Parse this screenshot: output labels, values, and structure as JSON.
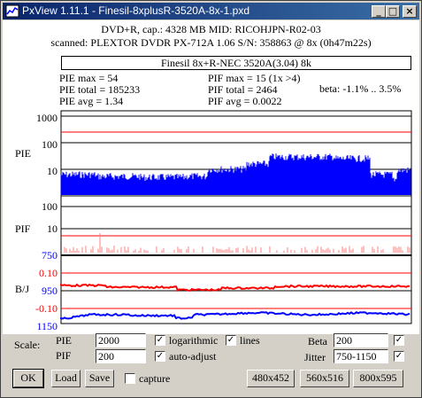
{
  "window": {
    "title": "PxView 1.11.1  -  Finesil-8xplusR-3520A-8x-1.pxd",
    "min_icon": "minimize-icon",
    "max_icon": "maximize-icon",
    "close_icon": "close-icon",
    "min_glyph": "_",
    "max_glyph": "□",
    "close_glyph": "×"
  },
  "header": {
    "line1": "DVD+R, cap.: 4328 MB MID: RICOHJPN-R02-03",
    "line2": "scanned: PLEXTOR DVDR PX-712A 1.06 S/N: 358863 @ 8x (0h47m22s)",
    "disc": "Finesil 8x+R-NEC 3520A(3.04) 8k"
  },
  "stats": {
    "pie_max": "PIE max = 54",
    "pie_total": "PIE total = 185233",
    "pie_avg": "PIE avg = 1.34",
    "pif_max": "PIF max = 15 (1x >4)",
    "pif_total": "PIF total = 2464",
    "pif_avg": "PIF avg = 0.0022",
    "beta": "beta: -1.1% .. 3.5%"
  },
  "graph": {
    "pie_label": "PIE",
    "pif_label": "PIF",
    "bj_label": "B/J",
    "pie_ticks": [
      "1000",
      "100",
      "10"
    ],
    "pif_ticks": [
      "100",
      "10"
    ],
    "bj_ticks": [
      "750",
      "0.10",
      "950",
      "-0.10",
      "1150"
    ],
    "colors": {
      "pie": "#0000ff",
      "pif": "#ff0000",
      "beta": "#ff0000",
      "jitter": "#0000ff",
      "threshold": "#ff0000"
    }
  },
  "controls": {
    "scale_label": "Scale:",
    "pie_label": "PIE",
    "pie_value": "2000",
    "pif_label": "PIF",
    "pif_value": "200",
    "logarithmic_label": "logarithmic",
    "logarithmic_checked": true,
    "lines_label": "lines",
    "lines_checked": true,
    "auto_adjust_label": "auto-adjust",
    "auto_adjust_checked": true,
    "beta_label": "Beta",
    "beta_value": "200",
    "beta_checked": true,
    "jitter_label": "Jitter",
    "jitter_value": "750-1150",
    "jitter_checked": true,
    "capture_label": "capture",
    "capture_checked": false,
    "check_glyph": "✓",
    "ok": "OK",
    "load": "Load",
    "save": "Save",
    "size1": "480x452",
    "size2": "560x516",
    "size3": "800x595"
  }
}
